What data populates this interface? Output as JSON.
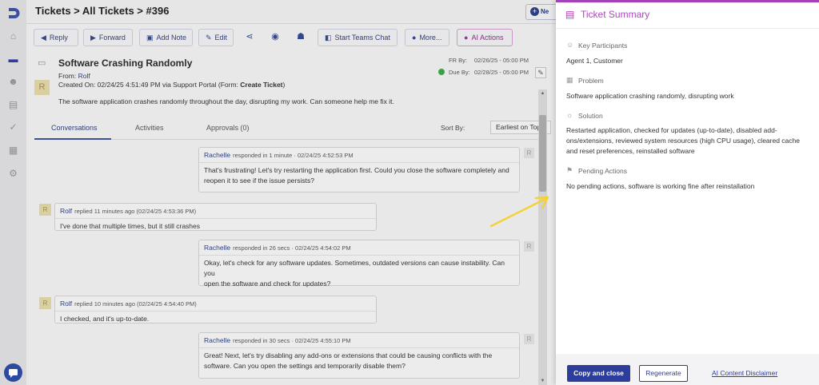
{
  "breadcrumb": "Tickets > All Tickets > #396",
  "new_button_label": "Ne",
  "toolbar": {
    "reply": "Reply",
    "forward": "Forward",
    "add_note": "Add Note",
    "edit": "Edit",
    "teams": "Start Teams Chat",
    "more": "More...",
    "ai": "AI Actions"
  },
  "ticket": {
    "title": "Software Crashing Randomly",
    "avatar": "R",
    "from_label": "From:",
    "from_name": "Rolf",
    "created": "Created On: 02/24/25 4:51:49 PM via Support Portal (Form: ",
    "form_name": "Create Ticket",
    "form_close": ")",
    "description": "The software application crashes randomly throughout the day, disrupting my work. Can someone help me fix it.",
    "fr_label": "FR By:",
    "fr_value": "02/26/25 - 05:00 PM",
    "due_label": "Due By:",
    "due_value": "02/28/25 - 05:00 PM"
  },
  "tabs": [
    "Conversations",
    "Activities",
    "Approvals (0)"
  ],
  "sort": {
    "label": "Sort By:",
    "value": "Earliest on Top"
  },
  "messages": [
    {
      "name": "Rachelle",
      "meta": "responded in 1 minute  ·  02/24/25 4:52:53 PM",
      "avatar": "R",
      "lines": [
        "That's frustrating! Let's try restarting the application first. Could you close the software completely and",
        "reopen it to see if the issue persists?"
      ]
    },
    {
      "name": "Rolf",
      "meta": "replied 11 minutes ago (02/24/25 4:53:36 PM)",
      "avatar": "R",
      "lines": [
        "I've done that multiple times, but it still crashes"
      ]
    },
    {
      "name": "Rachelle",
      "meta": "responded in 26 secs  ·  02/24/25 4:54:02 PM",
      "avatar": "R",
      "lines": [
        "Okay, let's check for any software updates. Sometimes, outdated versions can cause instability. Can you",
        "open the software and check for updates?"
      ]
    },
    {
      "name": "Rolf",
      "meta": "replied 10 minutes ago (02/24/25 4:54:40 PM)",
      "avatar": "R",
      "lines": [
        "I checked, and it's up-to-date."
      ]
    },
    {
      "name": "Rachelle",
      "meta": "responded in 30 secs  ·  02/24/25 4:55:10 PM",
      "avatar": "R",
      "lines": [
        "Great! Next, let's try disabling any add-ons or extensions that could be causing conflicts with the",
        "software. Can you open the settings and temporarily disable them?"
      ]
    }
  ],
  "panel": {
    "title": "Ticket Summary",
    "sections": [
      {
        "icon": "participants-icon",
        "heading": "Key Participants",
        "lines": [
          "Agent 1, Customer"
        ]
      },
      {
        "icon": "problem-icon",
        "heading": "Problem",
        "lines": [
          "Software application crashing randomly, disrupting work"
        ]
      },
      {
        "icon": "solution-icon",
        "heading": "Solution",
        "lines": [
          "Restarted application, checked for updates (up-to-date), disabled add-",
          "ons/extensions, reviewed system resources (high CPU usage), cleared cache",
          "and reset preferences, reinstalled software"
        ]
      },
      {
        "icon": "pending-icon",
        "heading": "Pending Actions",
        "lines": [
          "No pending actions, software is working fine after reinstallation"
        ]
      }
    ],
    "copy_close": "Copy and close",
    "regenerate": "Regenerate",
    "disclaimer": "AI Content Disclaimer"
  },
  "colors": {
    "accent": "#a640b8",
    "primary": "#2c3d9b",
    "arrow": "#f2d23a"
  }
}
